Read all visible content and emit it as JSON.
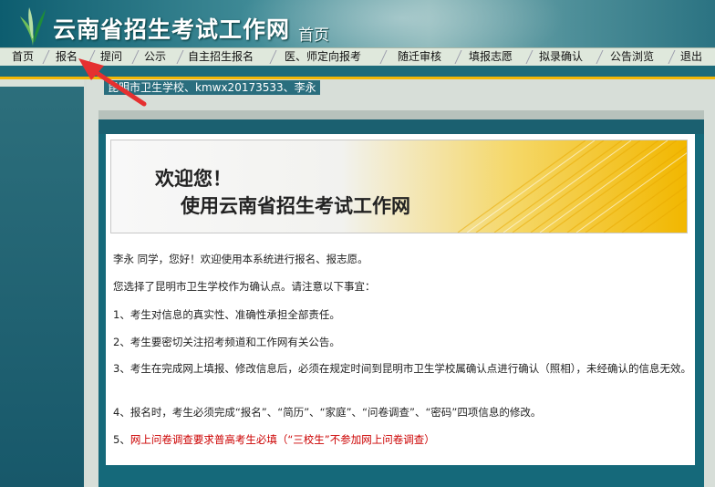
{
  "header": {
    "site_title": "云南省招生考试工作网",
    "page_label": "首页"
  },
  "nav": {
    "items": [
      "首页",
      "报名",
      "提问",
      "公示",
      "自主招生报名",
      "医、师定向报考",
      "随迁审核",
      "填报志愿",
      "拟录确认",
      "公告浏览",
      "退出"
    ]
  },
  "breadcrumb": "昆明市卫生学校、kmwx20173533、李永",
  "banner": {
    "welcome": "欢迎您！",
    "use": "使用云南省招生考试工作网"
  },
  "notice": {
    "greeting": "李永 同学，您好！欢迎使用本系统进行报名、报志愿。",
    "intro": "您选择了昆明市卫生学校作为确认点。请注意以下事宜：",
    "item1": "1、考生对信息的真实性、准确性承担全部责任。",
    "item2": "2、考生要密切关注招考频道和工作网有关公告。",
    "item3": "3、考生在完成网上填报、修改信息后，必须在规定时间到昆明市卫生学校属确认点进行确认（照相），未经确认的信息无效。",
    "item4": "4、报名时，考生必须完成“报名”、“简历”、“家庭”、“问卷调查”、“密码”四项信息的修改。",
    "item5_prefix": "5、",
    "item5": "网上问卷调查要求普高考生必填（“三校生”不参加网上问卷调查）"
  },
  "colors": {
    "header_teal": "#1a6a7b",
    "accent_yellow": "#f2b705",
    "warning_red": "#cc0000",
    "arrow_red": "#e53030"
  }
}
